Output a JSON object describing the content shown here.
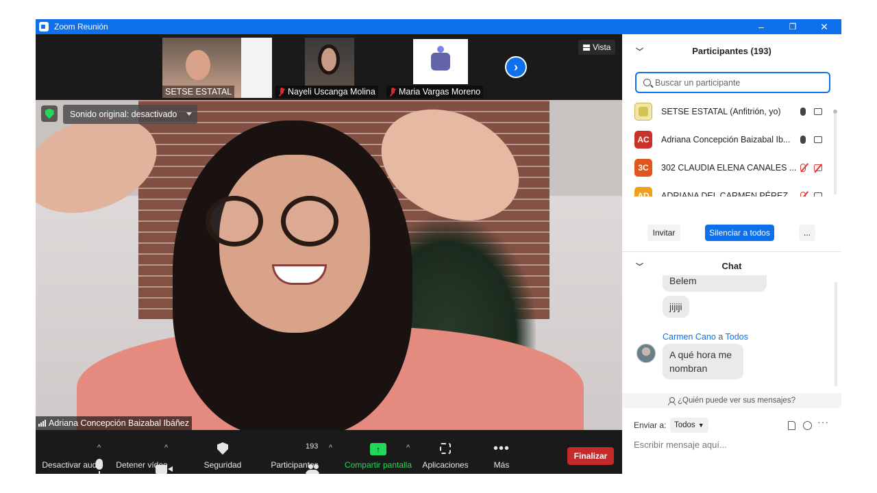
{
  "window": {
    "title": "Zoom Reunión",
    "controls": [
      "–",
      "❐",
      "✕"
    ]
  },
  "thumbnails": [
    {
      "name": "SETSE ESTATAL",
      "muted": false
    },
    {
      "name": "Nayeli Uscanga Molina",
      "muted": true
    },
    {
      "name": "Maria Vargas Moreno",
      "muted": true
    }
  ],
  "view_button": "Vista",
  "main_video": {
    "sound_setting": "Sonido original: desactivado",
    "speaker_name": "Adriana Concepción Baizabal Ibáñez"
  },
  "toolbar": {
    "mute_label": "Desactivar audio",
    "video_label": "Detener vídeo",
    "security_label": "Seguridad",
    "participants_label": "Participantes",
    "participants_count": "193",
    "share_label": "Compartir pantalla",
    "apps_label": "Aplicaciones",
    "more_label": "Más",
    "end_label": "Finalizar"
  },
  "participants_panel": {
    "title": "Participantes (193)",
    "search_placeholder": "Buscar un participante",
    "participants": [
      {
        "initials": "",
        "name": "SETSE ESTATAL (Anfitrión, yo)",
        "avatar_color": "#f2e6a6",
        "mic_muted": false,
        "video_off": false
      },
      {
        "initials": "AC",
        "name": "Adriana Concepción Baizabal Ib...",
        "avatar_color": "#c8322a",
        "mic_muted": false,
        "video_off": false
      },
      {
        "initials": "3C",
        "name": "302 CLAUDIA ELENA CANALES ...",
        "avatar_color": "#e0561b",
        "mic_muted": true,
        "video_off": true
      },
      {
        "initials": "AD",
        "name": "ADRIANA DEL CARMEN PÉREZ ...",
        "avatar_color": "#f0a01e",
        "mic_muted": true,
        "video_off": false
      }
    ],
    "invite_label": "Invitar",
    "mute_all_label": "Silenciar a todos",
    "more_label": "..."
  },
  "chat_panel": {
    "title": "Chat",
    "messages": [
      {
        "text": "Belem"
      },
      {
        "text": "jijiji"
      },
      {
        "sender": "Carmen Cano",
        "connector": "a",
        "recipient": "Todos",
        "text": "A qué hora me nombran"
      }
    ],
    "who_can_see": "¿Quién puede ver sus mensajes?",
    "send_to_label": "Enviar a:",
    "send_to_value": "Todos",
    "input_placeholder": "Escribir mensaje aquí..."
  },
  "colors": {
    "accent": "#0e71eb",
    "end_button": "#c42a2a",
    "share_green": "#23d959"
  }
}
